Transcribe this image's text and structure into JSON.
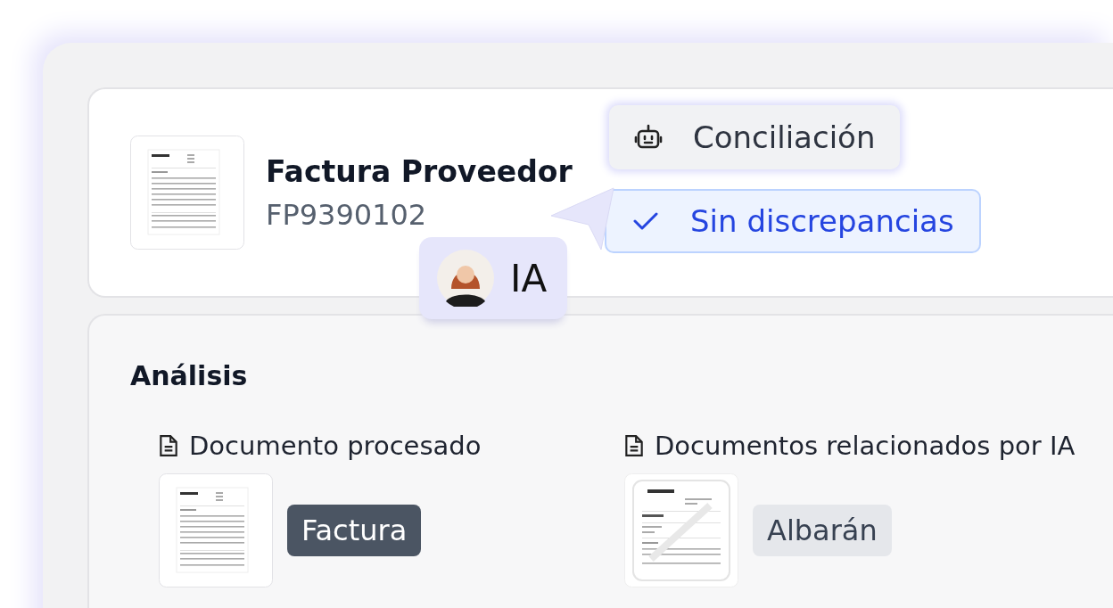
{
  "document": {
    "title": "Factura Proveedor",
    "number": "FP9390102"
  },
  "ai_badge": {
    "label": "IA"
  },
  "status": [
    {
      "kind": "process",
      "label": "Conciliación"
    },
    {
      "kind": "result",
      "label": "Sin discrepancias"
    }
  ],
  "analysis": {
    "title": "Análisis",
    "sections": [
      {
        "heading": "Documento procesado",
        "thumbnail": {
          "kind": "invoice"
        },
        "tag": {
          "label": "Factura",
          "selected": true
        }
      },
      {
        "heading": "Documentos relacionados por IA",
        "thumbnail": {
          "kind": "delivery-note"
        },
        "tag": {
          "label": "Albarán",
          "selected": false
        }
      }
    ]
  }
}
